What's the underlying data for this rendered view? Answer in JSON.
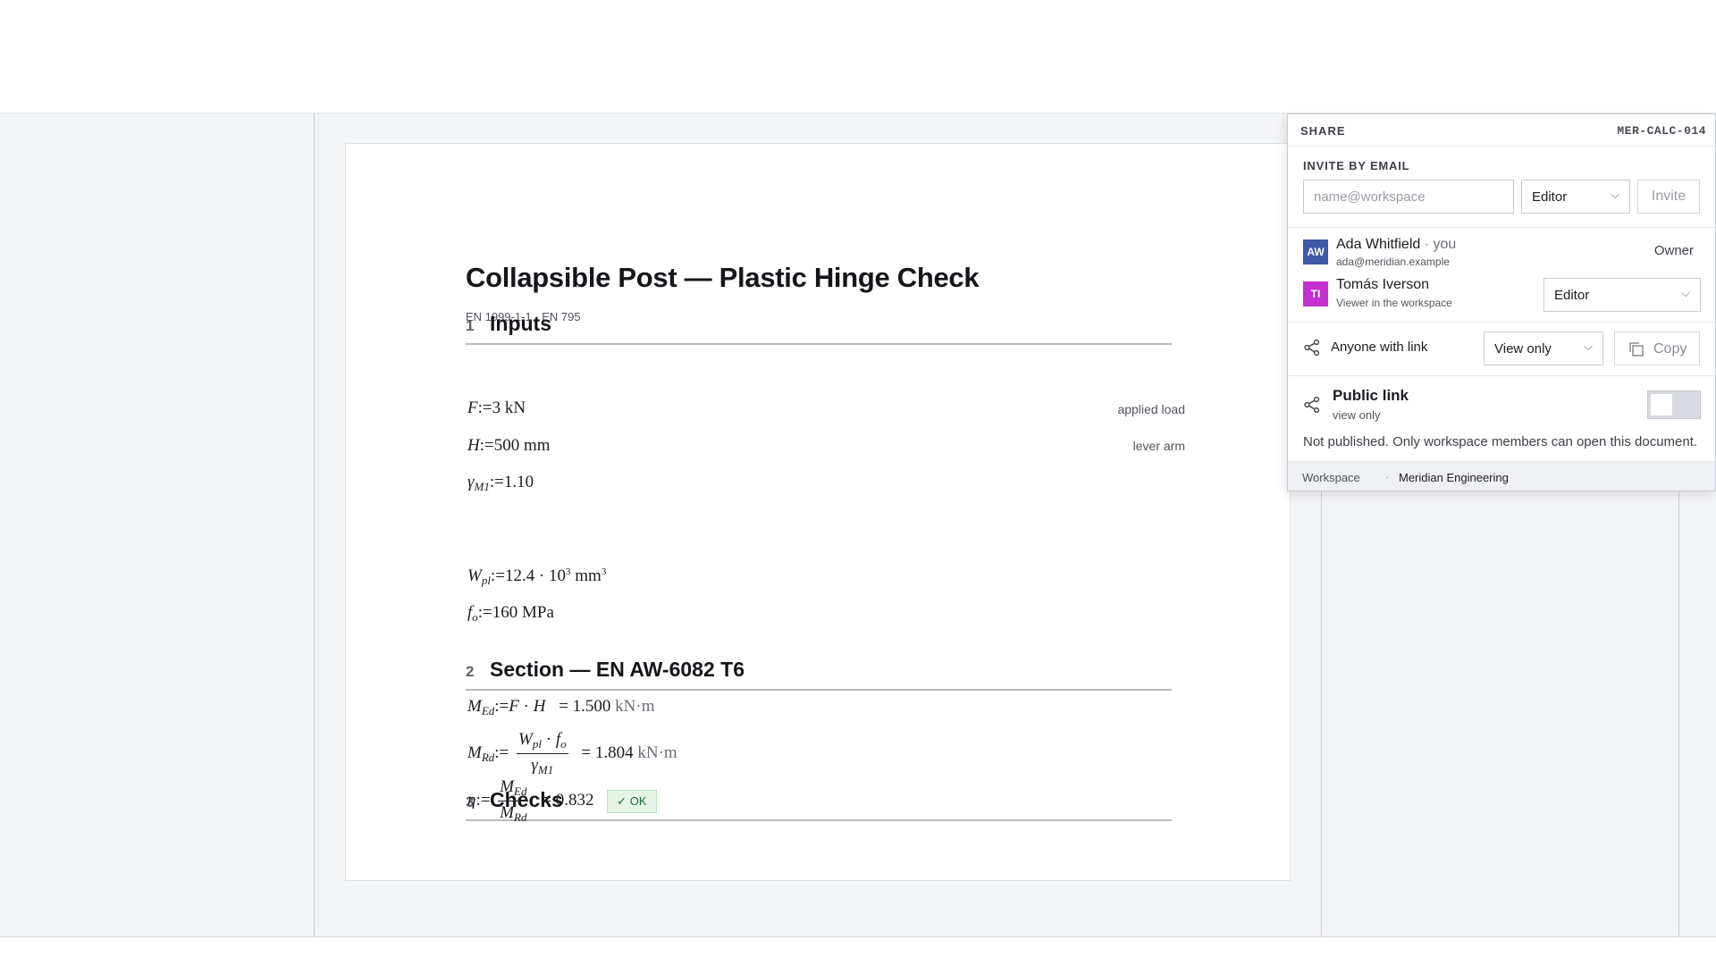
{
  "document": {
    "title": "Collapsible Post — Plastic Hinge Check",
    "subtitle": "EN 1999-1-1 · EN 795",
    "sections": [
      {
        "number": "1",
        "title": "Inputs"
      },
      {
        "number": "2",
        "title": "Section — EN AW-6082 T6"
      },
      {
        "number": "3",
        "title": "Checks"
      }
    ],
    "inputs": {
      "F": {
        "symbol": "F",
        "assign": ":=",
        "value": "3 kN",
        "note": "applied load"
      },
      "H": {
        "symbol": "H",
        "assign": ":=",
        "value": "500 mm",
        "note": "lever arm"
      },
      "gamma": {
        "symbol": "γ",
        "sub": "M1",
        "assign": ":=",
        "value": "1.10"
      }
    },
    "section": {
      "Wpl": {
        "symbol": "W",
        "sub": "pl",
        "assign": ":=",
        "value": "12.4 · 10",
        "exp": "3",
        "unit": " mm",
        "unit_exp": "3"
      },
      "fo": {
        "symbol": "f",
        "sub": "o",
        "assign": ":=",
        "value": "160 MPa"
      }
    },
    "checks": {
      "MEd": {
        "symbol": "M",
        "sub": "Ed",
        "assign": ":=",
        "expr_a": "F",
        "dot": " · ",
        "expr_b": "H",
        "eq": "=",
        "result": "1.500",
        "unit": "kN·m"
      },
      "MRd": {
        "symbol": "M",
        "sub": "Rd",
        "assign": ":=",
        "num_a": "W",
        "num_a_sub": "pl",
        "num_dot": " · ",
        "num_b": "f",
        "num_b_sub": "o",
        "den": "γ",
        "den_sub": "M1",
        "eq": "=",
        "result": "1.804",
        "unit": "kN·m"
      },
      "eta": {
        "symbol": "η",
        "assign": ":=",
        "num": "M",
        "num_sub": "Ed",
        "den": "M",
        "den_sub": "Rd",
        "eq": "=",
        "result": "0.832",
        "status": "OK"
      }
    }
  },
  "share": {
    "label": "SHARE",
    "doc_id": "MER-CALC-014",
    "invite_label": "INVITE BY EMAIL",
    "email_placeholder": "name@workspace",
    "invite_role": "Editor",
    "invite_button": "Invite",
    "members": [
      {
        "initials": "AW",
        "name": "Ada Whitfield",
        "suffix": " · you",
        "sub": "ada@meridian.example",
        "role": "Owner",
        "color": "#3e5aa8"
      },
      {
        "initials": "TI",
        "name": "Tomás Iverson",
        "sub": "Viewer in the workspace",
        "role": "Editor",
        "color": "#c32fd0"
      }
    ],
    "link_label": "Anyone with link",
    "link_access": "View only",
    "copy_button": "Copy",
    "public_title": "Public link",
    "public_sub": "view only",
    "public_enabled": false,
    "public_note": "Not published. Only workspace members can open this document.",
    "footer_label": "Workspace",
    "footer_value": "Meridian Engineering"
  },
  "icons": {
    "link": "share-nodes-icon",
    "copy": "copy-icon",
    "chevron": "chevron-down-icon",
    "check": "check-icon"
  },
  "colors": {
    "ok_bg": "#e5f5e8",
    "ok_text": "#1d6b34",
    "workspace_bg": "#f3f4f6"
  }
}
